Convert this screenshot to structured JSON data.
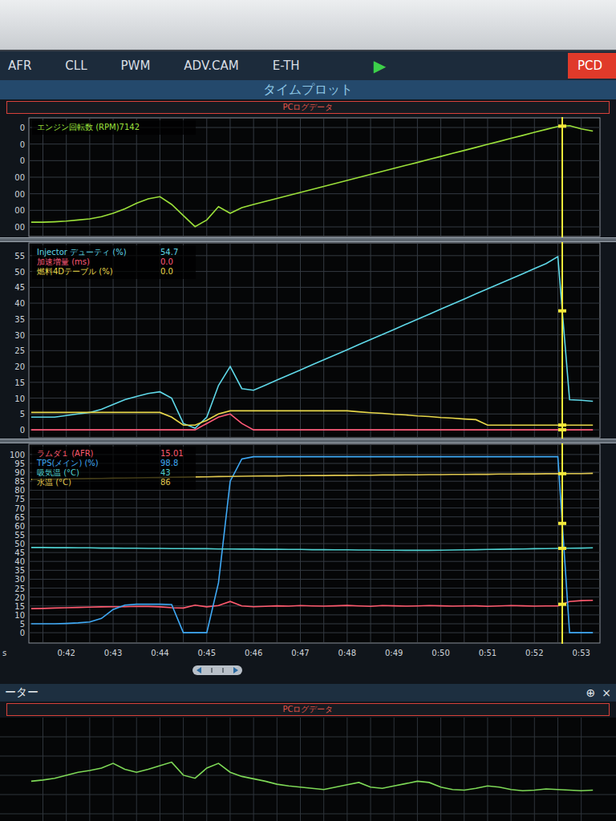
{
  "window": {
    "title": "タイムプロット"
  },
  "tabs": [
    {
      "label": "AFR",
      "selected": false
    },
    {
      "label": "CLL",
      "selected": false
    },
    {
      "label": "PWM",
      "selected": false
    },
    {
      "label": "ADV.CAM",
      "selected": false
    },
    {
      "label": "E-TH",
      "selected": false
    }
  ],
  "run_button": "▶",
  "device_button": "PCD",
  "log_source": "PCログデータ",
  "charts": [
    {
      "kind": "inline",
      "ticks": [
        "0",
        "0",
        "0",
        "00",
        "00",
        "00",
        "00"
      ],
      "series": [
        {
          "label": "エンジン回転数 (RPM)",
          "value": "7142",
          "color": "#9be03a",
          "values": [
            2800,
            2800,
            2820,
            2850,
            2900,
            2950,
            3050,
            3200,
            3400,
            3650,
            3850,
            3950,
            3600,
            3100,
            2600,
            2900,
            3500,
            3200,
            3450,
            3600,
            3735,
            3870,
            4005,
            4140,
            4275,
            4410,
            4545,
            4680,
            4815,
            4950,
            5085,
            5220,
            5355,
            5490,
            5625,
            5760,
            5895,
            6030,
            6165,
            6300,
            6435,
            6570,
            6705,
            6840,
            6975,
            7110,
            7142,
            7000,
            6900
          ]
        }
      ]
    },
    {
      "kind": "table",
      "ticks": [
        "55",
        "50",
        "45",
        "40",
        "35",
        "30",
        "25",
        "20",
        "15",
        "10",
        "5",
        "0"
      ],
      "series": [
        {
          "label": "Injector デューティ (%)",
          "value": "54.7",
          "color": "#5fd8e8",
          "values": [
            4,
            4,
            4,
            4.5,
            5,
            5.5,
            6.5,
            8,
            9.5,
            10.5,
            11.5,
            12,
            10,
            2,
            0.5,
            4,
            14,
            20,
            13,
            12.5,
            14.1,
            15.7,
            17.3,
            18.9,
            20.5,
            22.1,
            23.7,
            25.3,
            26.9,
            28.5,
            30.1,
            31.7,
            33.3,
            34.9,
            36.5,
            38.1,
            39.7,
            41.3,
            42.9,
            44.5,
            46.1,
            47.7,
            49.3,
            50.9,
            52.5,
            54.7,
            9.5,
            9.3,
            9.0
          ]
        },
        {
          "label": "加速増量 (ms)",
          "value": "0.0",
          "color": "#ff5a78",
          "values": [
            0,
            0,
            0,
            0,
            0,
            0,
            0,
            0,
            0,
            0,
            0,
            0,
            0,
            0,
            0,
            2,
            4,
            5,
            2,
            0,
            0,
            0,
            0,
            0,
            0,
            0,
            0,
            0,
            0,
            0,
            0,
            0,
            0,
            0,
            0,
            0,
            0,
            0,
            0,
            0,
            0,
            0,
            0,
            0,
            0,
            0,
            0,
            0,
            0
          ]
        },
        {
          "label": "燃料4Dテーブル (%)",
          "value": "0.0",
          "color": "#e8d84a",
          "values": [
            5.5,
            5.5,
            5.5,
            5.5,
            5.5,
            5.5,
            5.5,
            5.5,
            5.5,
            5.5,
            5.5,
            5.5,
            4,
            1.5,
            1.5,
            3,
            5,
            6,
            6,
            6,
            6,
            6,
            6,
            6,
            6,
            6,
            6,
            6,
            5.7,
            5.4,
            5.2,
            4.9,
            4.7,
            4.4,
            4.2,
            3.9,
            3.7,
            3.4,
            3.2,
            1.5,
            1.5,
            1.5,
            1.5,
            1.5,
            1.5,
            1.5,
            1.5,
            1.5,
            1.5
          ]
        }
      ]
    },
    {
      "kind": "table",
      "ticks": [
        "100",
        "95",
        "90",
        "85",
        "80",
        "75",
        "70",
        "65",
        "60",
        "55",
        "50",
        "45",
        "40",
        "35",
        "30",
        "25",
        "20",
        "15",
        "10",
        "5",
        "0"
      ],
      "series": [
        {
          "label": "ラムダ１ (AFR)",
          "value": "15.01",
          "color": "#ff5a6e",
          "values": [
            13.5,
            13.6,
            13.8,
            14,
            14.2,
            14.3,
            14.5,
            14.6,
            14.6,
            14.8,
            14.7,
            14.5,
            14,
            13.8,
            15.5,
            14.5,
            15.2,
            17.5,
            15,
            14.6,
            14.8,
            15.1,
            14.9,
            15.2,
            15,
            14.9,
            15.1,
            15.3,
            15,
            14.8,
            15.2,
            15.1,
            14.9,
            15,
            15.2,
            15.1,
            14.9,
            15,
            15.1,
            14.8,
            15,
            15.2,
            15.1,
            14.9,
            15,
            15.01,
            17.5,
            18,
            18.2
          ]
        },
        {
          "label": "TPS(メイン) (%)",
          "value": "98.8",
          "color": "#3fa9f5",
          "values": [
            5,
            5,
            5,
            5.2,
            5.5,
            6,
            8,
            13,
            15.5,
            16,
            16,
            16,
            15.8,
            0,
            0,
            0,
            28,
            85,
            97.5,
            98.8,
            98.8,
            98.8,
            98.8,
            98.8,
            98.8,
            98.8,
            98.8,
            98.8,
            98.8,
            98.8,
            98.8,
            98.8,
            98.8,
            98.8,
            98.8,
            98.8,
            98.8,
            98.8,
            98.8,
            98.8,
            98.8,
            98.8,
            98.8,
            98.8,
            98.8,
            98.8,
            0,
            0,
            0
          ]
        },
        {
          "label": "吸気温 (°C)",
          "value": "43",
          "color": "#4fd0d0",
          "values": [
            47.8,
            47.8,
            47.7,
            47.7,
            47.6,
            47.6,
            47.5,
            47.5,
            47.4,
            47.4,
            47.3,
            47.3,
            47.2,
            47.2,
            47.1,
            47.1,
            47,
            47,
            46.9,
            46.9,
            46.8,
            46.8,
            46.7,
            46.7,
            46.6,
            46.6,
            46.5,
            46.5,
            46.4,
            46.4,
            46.3,
            46.3,
            46.2,
            46.2,
            46.2,
            46.3,
            46.4,
            46.5,
            46.6,
            46.7,
            46.8,
            46.9,
            47,
            47.1,
            47.2,
            47.3,
            47.4,
            47.5,
            47.6
          ]
        },
        {
          "label": "水温 (°C)",
          "value": "86",
          "color": "#e0c850",
          "values": [
            86,
            86.1,
            86.2,
            86.3,
            86.4,
            86.5,
            86.6,
            86.7,
            86.8,
            86.9,
            87,
            87.1,
            87.2,
            87.3,
            87.4,
            87.5,
            87.6,
            87.7,
            87.8,
            87.9,
            88,
            88,
            88.1,
            88.1,
            88.2,
            88.2,
            88.3,
            88.3,
            88.4,
            88.4,
            88.5,
            88.5,
            88.6,
            88.6,
            88.7,
            88.7,
            88.8,
            88.8,
            88.9,
            88.9,
            89,
            89,
            89.1,
            89.1,
            89.2,
            89.2,
            89.3,
            89.3,
            89.4
          ]
        }
      ]
    }
  ],
  "x_axis": {
    "unit": "s",
    "ticks": [
      "0:42",
      "0:43",
      "0:44",
      "0:45",
      "0:46",
      "0:47",
      "0:48",
      "0:49",
      "0:50",
      "0:51",
      "0:52",
      "0:53"
    ]
  },
  "cursor": {
    "level": 0.934
  },
  "bottom_panel": {
    "title": "ーター",
    "source": "PCログデータ",
    "icons": [
      "⊕",
      "×"
    ],
    "series": [
      {
        "color": "#7ed957",
        "values": [
          40,
          42,
          45,
          50,
          55,
          58,
          62,
          70,
          60,
          55,
          60,
          66,
          72,
          50,
          45,
          62,
          70,
          55,
          48,
          44,
          40,
          35,
          32,
          30,
          28,
          26,
          30,
          34,
          38,
          30,
          28,
          32,
          36,
          40,
          38,
          30,
          26,
          25,
          28,
          32,
          30,
          26,
          24,
          25,
          27,
          26,
          25,
          24,
          25
        ]
      }
    ]
  }
}
